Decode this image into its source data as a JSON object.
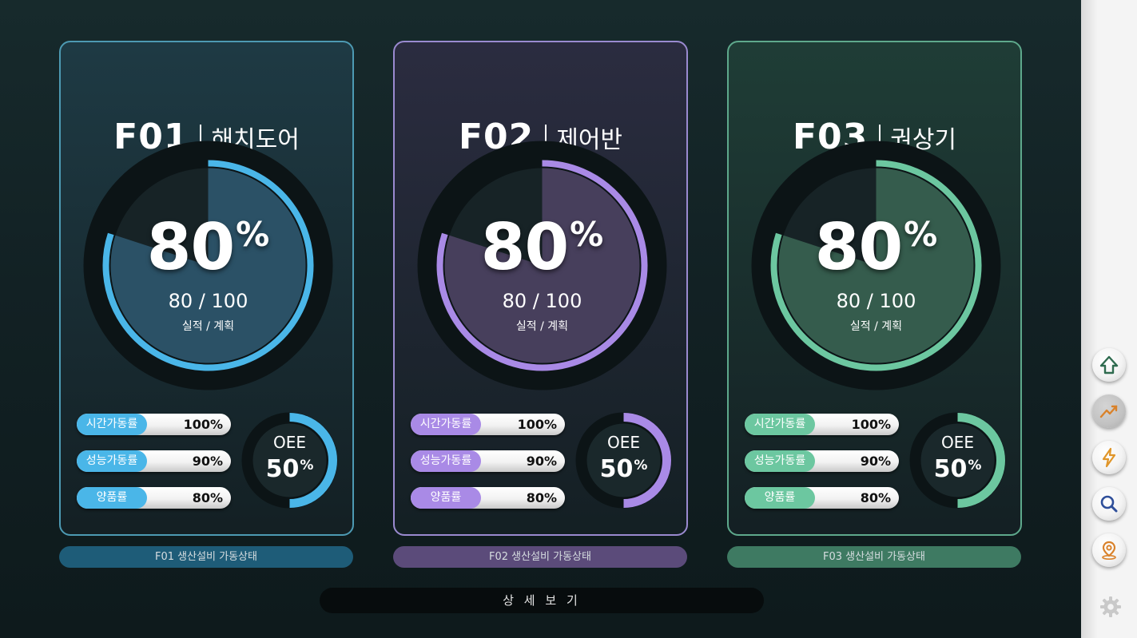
{
  "cards": [
    {
      "code": "F01",
      "name": "해치도어",
      "percent": "80",
      "percent_sign": "%",
      "ratio": "80 / 100",
      "ratio_label": "실적 / 계획",
      "progress": 0.8,
      "metrics": [
        {
          "label": "시간가동률",
          "value": "100%"
        },
        {
          "label": "성능가동률",
          "value": "90%"
        },
        {
          "label": "양품률",
          "value": "80%"
        }
      ],
      "oee_label": "OEE",
      "oee_value": "50",
      "oee_sign": "%",
      "oee_progress": 0.5,
      "caption": "F01 생산설비 가동상태",
      "accent": "#4ab6e8",
      "border": "#4d9ab3",
      "fill": "#2b5166",
      "card_bg": "#1e3a44",
      "caption_bg": "#1e5c78"
    },
    {
      "code": "F02",
      "name": "제어반",
      "percent": "80",
      "percent_sign": "%",
      "ratio": "80 / 100",
      "ratio_label": "실적 / 계획",
      "progress": 0.8,
      "metrics": [
        {
          "label": "시간가동률",
          "value": "100%"
        },
        {
          "label": "성능가동률",
          "value": "90%"
        },
        {
          "label": "양품률",
          "value": "80%"
        }
      ],
      "oee_label": "OEE",
      "oee_value": "50",
      "oee_sign": "%",
      "oee_progress": 0.5,
      "caption": "F02 생산설비 가동상태",
      "accent": "#a98ae6",
      "border": "#9a8ad0",
      "fill": "#473f5c",
      "card_bg": "#2b2c40",
      "caption_bg": "#5b4b7a"
    },
    {
      "code": "F03",
      "name": "권상기",
      "percent": "80",
      "percent_sign": "%",
      "ratio": "80 / 100",
      "ratio_label": "실적 / 계획",
      "progress": 0.8,
      "metrics": [
        {
          "label": "시간가동률",
          "value": "100%"
        },
        {
          "label": "성능가동률",
          "value": "90%"
        },
        {
          "label": "양품률",
          "value": "80%"
        }
      ],
      "oee_label": "OEE",
      "oee_value": "50",
      "oee_sign": "%",
      "oee_progress": 0.5,
      "caption": "F03 생산설비 가동상태",
      "accent": "#6cc7a0",
      "border": "#5ea98c",
      "fill": "#355c4d",
      "card_bg": "#1f3d36",
      "caption_bg": "#3e7a62"
    }
  ],
  "detail_button": "상 세 보 기",
  "sidebar": {
    "buttons": [
      {
        "icon": "home-up-icon",
        "active": false
      },
      {
        "icon": "trend-chart-icon",
        "active": true
      },
      {
        "icon": "lightning-icon",
        "active": false
      },
      {
        "icon": "search-icon",
        "active": false
      },
      {
        "icon": "location-pin-icon",
        "active": false
      }
    ],
    "settings_icon": "gear-icon"
  }
}
